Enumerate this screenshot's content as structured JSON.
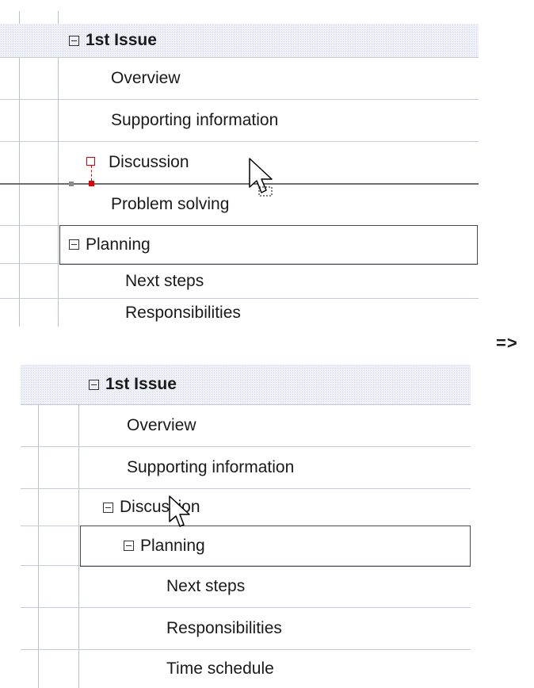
{
  "before": {
    "rows": [
      {
        "label": "1st Issue"
      },
      {
        "label": "Overview"
      },
      {
        "label": "Supporting information"
      },
      {
        "label": "Discussion"
      },
      {
        "label": "Problem solving"
      },
      {
        "label": "Planning"
      },
      {
        "label": "Next steps"
      },
      {
        "label": "Responsibilities"
      }
    ]
  },
  "after": {
    "rows": [
      {
        "label": "1st Issue"
      },
      {
        "label": "Overview"
      },
      {
        "label": "Supporting information"
      },
      {
        "label": "Discussion"
      },
      {
        "label": "Planning"
      },
      {
        "label": "Next steps"
      },
      {
        "label": "Responsibilities"
      },
      {
        "label": "Time schedule"
      }
    ]
  },
  "transition_arrow": "=>",
  "icons": {
    "collapse_toggle": "collapse-toggle-icon",
    "drop_marker": "drop-marker-icon",
    "cursor": "mouse-pointer-icon"
  },
  "colors": {
    "header_bg": "#eef0f8",
    "grid_line": "#c5cad8",
    "drop_indicator": "#e00000",
    "drop_line": "#6e6e6e"
  }
}
